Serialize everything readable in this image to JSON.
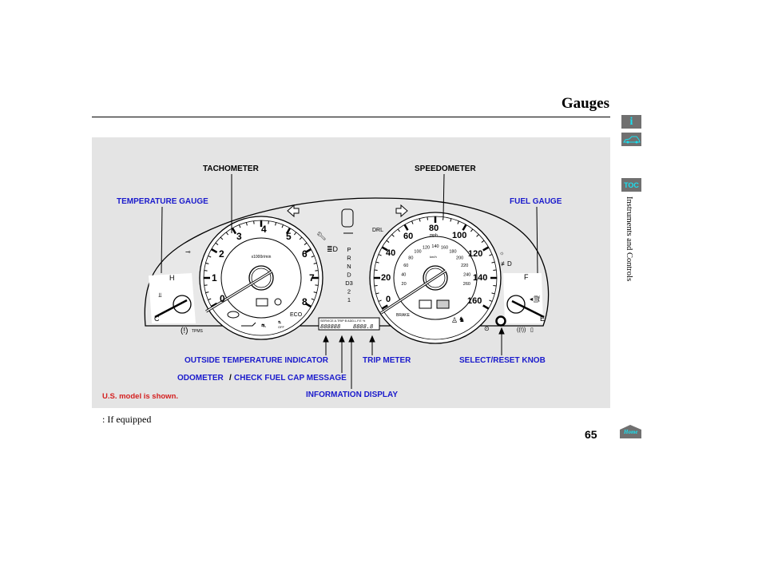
{
  "page": {
    "title": "Gauges",
    "page_number": "65",
    "footnote": ": If equipped",
    "section": "Instruments and Controls"
  },
  "sidebar": {
    "info_icon": "i",
    "toc_label": "TOC",
    "home_label": "Home"
  },
  "callouts": {
    "tachometer": "TACHOMETER",
    "speedometer": "SPEEDOMETER",
    "temperature_gauge": "TEMPERATURE GAUGE",
    "fuel_gauge": "FUEL GAUGE",
    "outside_temp": "OUTSIDE TEMPERATURE INDICATOR",
    "trip_meter": "TRIP METER",
    "select_reset": "SELECT/RESET KNOB",
    "odometer": "ODOMETER",
    "slash": "/",
    "check_fuel_cap": "CHECK FUEL CAP MESSAGE",
    "information_display": "INFORMATION DISPLAY",
    "model_note": "U.S. model is shown."
  },
  "cluster": {
    "tach_numbers": [
      "0",
      "1",
      "2",
      "3",
      "4",
      "5",
      "6",
      "7",
      "8"
    ],
    "tach_unit": "x1000r/min",
    "eco": "ECO",
    "tpms": "TPMS",
    "speed_mph": [
      "0",
      "20",
      "40",
      "60",
      "80",
      "100",
      "120",
      "140",
      "160"
    ],
    "speed_kmh": [
      "20",
      "40",
      "60",
      "80",
      "100",
      "120",
      "140",
      "160",
      "180",
      "200",
      "220",
      "240",
      "260"
    ],
    "mph_unit": "mph",
    "kmh_unit": "km/h",
    "brake": "BRAKE",
    "drl": "DRL",
    "gears": [
      "P",
      "R",
      "N",
      "D",
      "D3",
      "2",
      "1"
    ],
    "temp_hot": "H",
    "temp_cold": "C",
    "fuel_full": "F",
    "fuel_empty": "E",
    "display_header": "SERVICE  A.TRIP B ADD.L.F.E %",
    "display_odo": "888888",
    "display_trip": "8888.8",
    "off": "OFF"
  }
}
